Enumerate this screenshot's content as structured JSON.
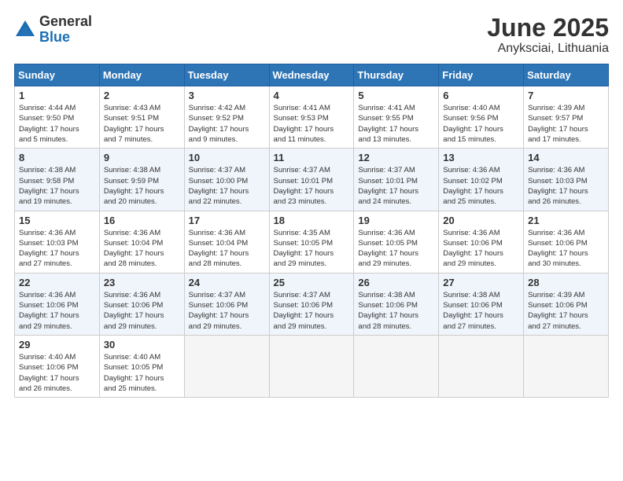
{
  "logo": {
    "general": "General",
    "blue": "Blue"
  },
  "title": "June 2025",
  "subtitle": "Anyksciai, Lithuania",
  "weekdays": [
    "Sunday",
    "Monday",
    "Tuesday",
    "Wednesday",
    "Thursday",
    "Friday",
    "Saturday"
  ],
  "weeks": [
    [
      {
        "day": "1",
        "info": "Sunrise: 4:44 AM\nSunset: 9:50 PM\nDaylight: 17 hours\nand 5 minutes."
      },
      {
        "day": "2",
        "info": "Sunrise: 4:43 AM\nSunset: 9:51 PM\nDaylight: 17 hours\nand 7 minutes."
      },
      {
        "day": "3",
        "info": "Sunrise: 4:42 AM\nSunset: 9:52 PM\nDaylight: 17 hours\nand 9 minutes."
      },
      {
        "day": "4",
        "info": "Sunrise: 4:41 AM\nSunset: 9:53 PM\nDaylight: 17 hours\nand 11 minutes."
      },
      {
        "day": "5",
        "info": "Sunrise: 4:41 AM\nSunset: 9:55 PM\nDaylight: 17 hours\nand 13 minutes."
      },
      {
        "day": "6",
        "info": "Sunrise: 4:40 AM\nSunset: 9:56 PM\nDaylight: 17 hours\nand 15 minutes."
      },
      {
        "day": "7",
        "info": "Sunrise: 4:39 AM\nSunset: 9:57 PM\nDaylight: 17 hours\nand 17 minutes."
      }
    ],
    [
      {
        "day": "8",
        "info": "Sunrise: 4:38 AM\nSunset: 9:58 PM\nDaylight: 17 hours\nand 19 minutes."
      },
      {
        "day": "9",
        "info": "Sunrise: 4:38 AM\nSunset: 9:59 PM\nDaylight: 17 hours\nand 20 minutes."
      },
      {
        "day": "10",
        "info": "Sunrise: 4:37 AM\nSunset: 10:00 PM\nDaylight: 17 hours\nand 22 minutes."
      },
      {
        "day": "11",
        "info": "Sunrise: 4:37 AM\nSunset: 10:01 PM\nDaylight: 17 hours\nand 23 minutes."
      },
      {
        "day": "12",
        "info": "Sunrise: 4:37 AM\nSunset: 10:01 PM\nDaylight: 17 hours\nand 24 minutes."
      },
      {
        "day": "13",
        "info": "Sunrise: 4:36 AM\nSunset: 10:02 PM\nDaylight: 17 hours\nand 25 minutes."
      },
      {
        "day": "14",
        "info": "Sunrise: 4:36 AM\nSunset: 10:03 PM\nDaylight: 17 hours\nand 26 minutes."
      }
    ],
    [
      {
        "day": "15",
        "info": "Sunrise: 4:36 AM\nSunset: 10:03 PM\nDaylight: 17 hours\nand 27 minutes."
      },
      {
        "day": "16",
        "info": "Sunrise: 4:36 AM\nSunset: 10:04 PM\nDaylight: 17 hours\nand 28 minutes."
      },
      {
        "day": "17",
        "info": "Sunrise: 4:36 AM\nSunset: 10:04 PM\nDaylight: 17 hours\nand 28 minutes."
      },
      {
        "day": "18",
        "info": "Sunrise: 4:35 AM\nSunset: 10:05 PM\nDaylight: 17 hours\nand 29 minutes."
      },
      {
        "day": "19",
        "info": "Sunrise: 4:36 AM\nSunset: 10:05 PM\nDaylight: 17 hours\nand 29 minutes."
      },
      {
        "day": "20",
        "info": "Sunrise: 4:36 AM\nSunset: 10:06 PM\nDaylight: 17 hours\nand 29 minutes."
      },
      {
        "day": "21",
        "info": "Sunrise: 4:36 AM\nSunset: 10:06 PM\nDaylight: 17 hours\nand 30 minutes."
      }
    ],
    [
      {
        "day": "22",
        "info": "Sunrise: 4:36 AM\nSunset: 10:06 PM\nDaylight: 17 hours\nand 29 minutes."
      },
      {
        "day": "23",
        "info": "Sunrise: 4:36 AM\nSunset: 10:06 PM\nDaylight: 17 hours\nand 29 minutes."
      },
      {
        "day": "24",
        "info": "Sunrise: 4:37 AM\nSunset: 10:06 PM\nDaylight: 17 hours\nand 29 minutes."
      },
      {
        "day": "25",
        "info": "Sunrise: 4:37 AM\nSunset: 10:06 PM\nDaylight: 17 hours\nand 29 minutes."
      },
      {
        "day": "26",
        "info": "Sunrise: 4:38 AM\nSunset: 10:06 PM\nDaylight: 17 hours\nand 28 minutes."
      },
      {
        "day": "27",
        "info": "Sunrise: 4:38 AM\nSunset: 10:06 PM\nDaylight: 17 hours\nand 27 minutes."
      },
      {
        "day": "28",
        "info": "Sunrise: 4:39 AM\nSunset: 10:06 PM\nDaylight: 17 hours\nand 27 minutes."
      }
    ],
    [
      {
        "day": "29",
        "info": "Sunrise: 4:40 AM\nSunset: 10:06 PM\nDaylight: 17 hours\nand 26 minutes."
      },
      {
        "day": "30",
        "info": "Sunrise: 4:40 AM\nSunset: 10:05 PM\nDaylight: 17 hours\nand 25 minutes."
      },
      null,
      null,
      null,
      null,
      null
    ]
  ]
}
